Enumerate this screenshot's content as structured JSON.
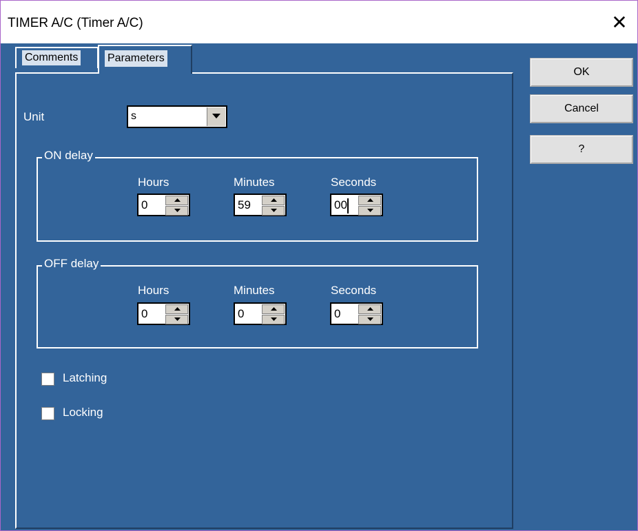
{
  "window": {
    "title": "TIMER A/C (Timer A/C)",
    "close_glyph": "✕"
  },
  "tabs": [
    {
      "label": "Comments",
      "active": false
    },
    {
      "label": "Parameters",
      "active": true
    }
  ],
  "unit": {
    "label": "Unit",
    "value": "s"
  },
  "on_delay": {
    "title": "ON delay",
    "hours": {
      "label": "Hours",
      "value": "0"
    },
    "minutes": {
      "label": "Minutes",
      "value": "59"
    },
    "seconds": {
      "label": "Seconds",
      "value": "00"
    }
  },
  "off_delay": {
    "title": "OFF delay",
    "hours": {
      "label": "Hours",
      "value": "0"
    },
    "minutes": {
      "label": "Minutes",
      "value": "0"
    },
    "seconds": {
      "label": "Seconds",
      "value": "0"
    }
  },
  "options": {
    "latching": {
      "label": "Latching",
      "checked": false
    },
    "locking": {
      "label": "Locking",
      "checked": false
    }
  },
  "buttons": {
    "ok": "OK",
    "cancel": "Cancel",
    "help": "?"
  },
  "colors": {
    "background": "#33649a",
    "accent_border": "#a865c9"
  }
}
